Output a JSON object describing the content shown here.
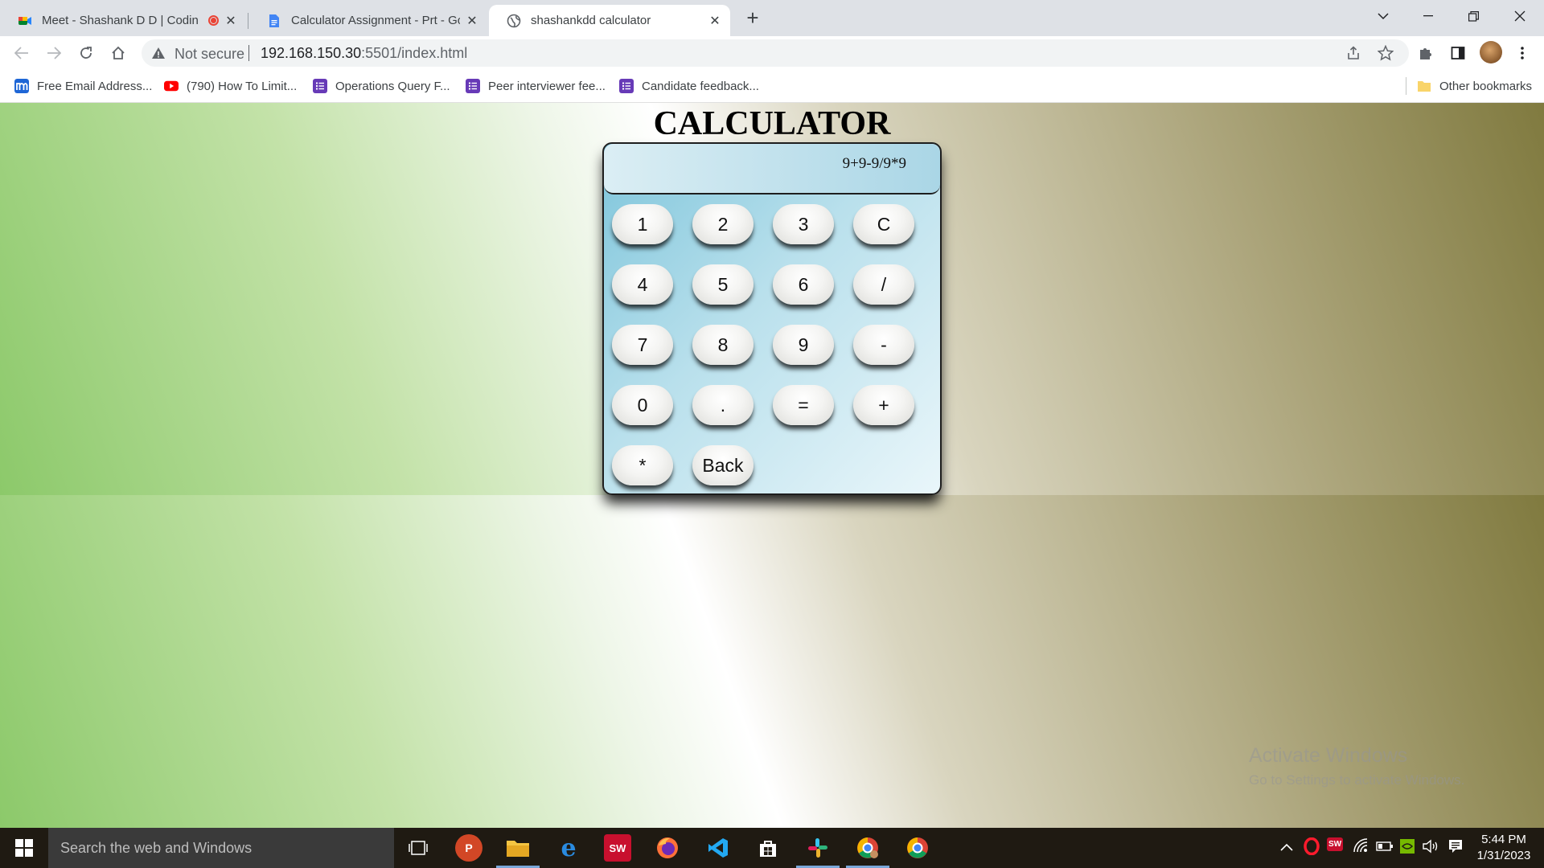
{
  "browser": {
    "tabs": [
      {
        "title": "Meet - Shashank D D | Codin",
        "icon": "google-meet-icon",
        "recording": true,
        "active": false
      },
      {
        "title": "Calculator Assignment - Prt - Goo",
        "icon": "google-docs-icon",
        "active": false
      },
      {
        "title": "shashankdd calculator",
        "icon": "globe-icon",
        "active": true
      }
    ],
    "address": {
      "security_label": "Not secure",
      "host": "192.168.150.30",
      "path": ":5501/index.html"
    },
    "bookmarks": [
      {
        "label": "Free Email Address...",
        "icon": "m-logo-icon"
      },
      {
        "label": "(790) How To Limit...",
        "icon": "youtube-icon"
      },
      {
        "label": "Operations Query F...",
        "icon": "forms-icon"
      },
      {
        "label": "Peer interviewer fee...",
        "icon": "forms-icon"
      },
      {
        "label": "Candidate feedback...",
        "icon": "forms-icon"
      }
    ],
    "other_bookmarks": "Other bookmarks"
  },
  "page": {
    "title": "CALCULATOR",
    "display": "9+9-9/9*9",
    "keys": [
      [
        "1",
        "2",
        "3",
        "C"
      ],
      [
        "4",
        "5",
        "6",
        "/"
      ],
      [
        "7",
        "8",
        "9",
        "-"
      ],
      [
        "0",
        ".",
        "=",
        "+"
      ],
      [
        "*",
        "Back"
      ]
    ]
  },
  "watermark": {
    "line1": "Activate Windows",
    "line2": "Go to Settings to activate Windows."
  },
  "taskbar": {
    "search_placeholder": "Search the web and Windows",
    "time": "5:44 PM",
    "date": "1/31/2023"
  }
}
